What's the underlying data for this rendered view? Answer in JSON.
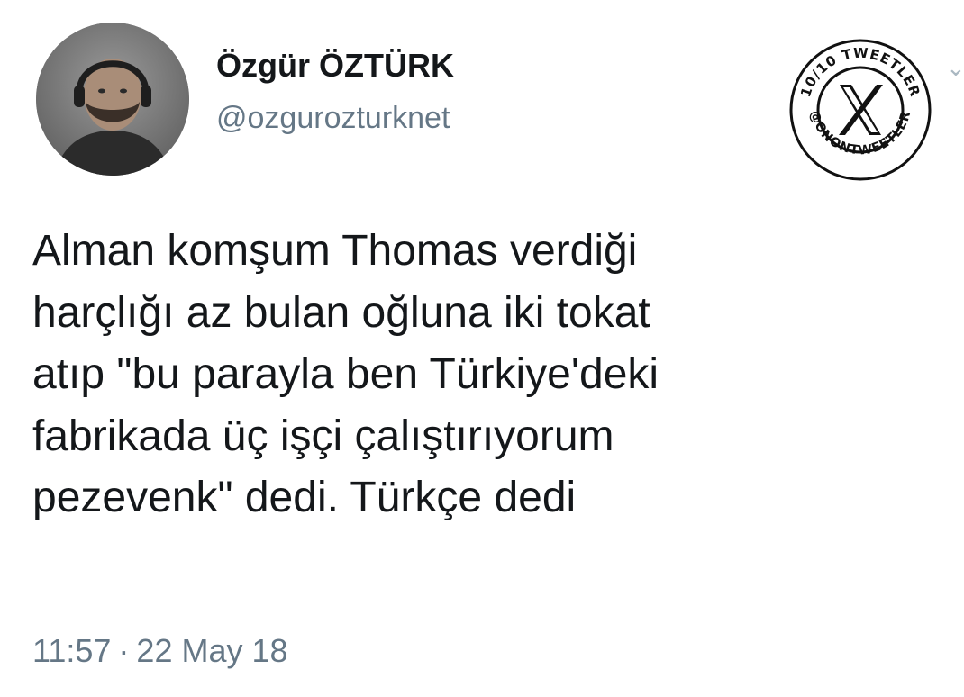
{
  "author": {
    "display_name": "Özgür ÖZTÜRK",
    "handle": "@ozgurozturknet",
    "avatar_icon": "profile-photo"
  },
  "tweet": {
    "lines": [
      "Alman komşum Thomas verdiği",
      "harçlığı az bulan oğluna iki tokat",
      "atıp \"bu parayla ben Türkiye'deki",
      "fabrikada üç işçi çalıştırıyorum",
      "pezevenk\" dedi. Türkçe dedi"
    ],
    "time": "11:57",
    "separator": "·",
    "date": "22 May 18"
  },
  "watermark": {
    "top_text": "10/10 TWEETLER",
    "bottom_text": "@ONONTWEETLER",
    "logo": "X"
  },
  "menu_icon": "chevron-down-icon",
  "colors": {
    "text": "#14171a",
    "secondary": "#657786",
    "background": "#ffffff"
  }
}
